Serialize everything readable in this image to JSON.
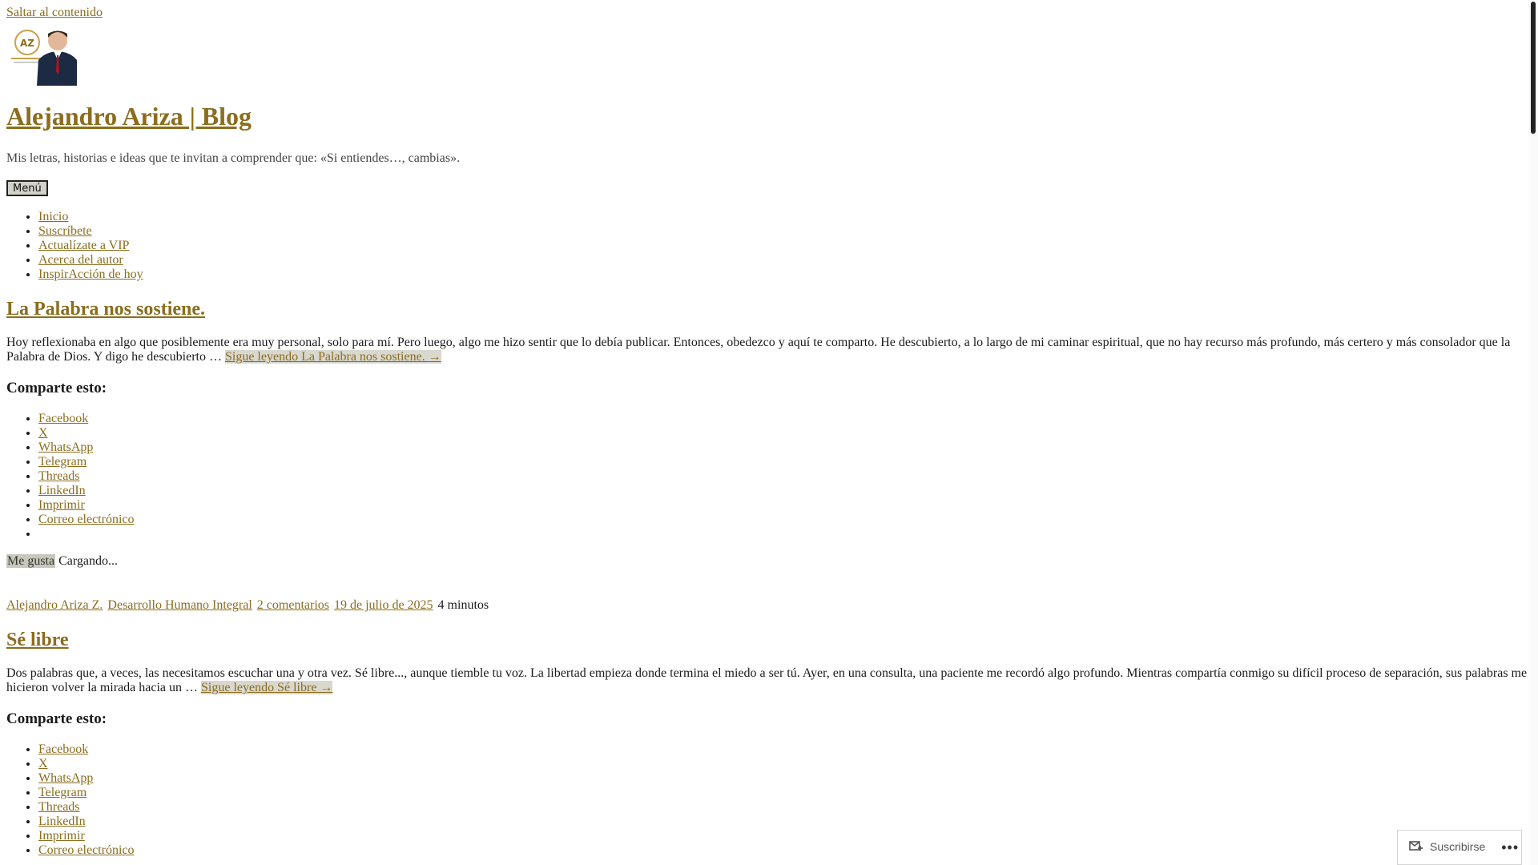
{
  "skip_link": "Saltar al contenido",
  "site": {
    "title": "Alejandro Ariza | Blog",
    "description": "Mis letras, historias e ideas que te invitan a comprender que: «Si entiendes…, cambias».",
    "logo_text": "AZ"
  },
  "menu_toggle": "Menú",
  "nav": [
    "Inicio",
    "Suscríbete",
    "Actualízate a VIP",
    "Acerca del autor",
    "InspirAcción de hoy"
  ],
  "share_heading": "Comparte esto:",
  "share_items": [
    "Facebook",
    "X",
    "WhatsApp",
    "Telegram",
    "Threads",
    "LinkedIn",
    "Imprimir",
    "Correo electrónico"
  ],
  "likes": {
    "button": "Me gusta",
    "status": "Cargando..."
  },
  "posts": [
    {
      "title": "La Palabra nos sostiene.",
      "excerpt": "Hoy reflexionaba en algo que posiblemente era muy personal, solo para mí. Pero luego, algo me hizo sentir que lo debía publicar. Entonces, obedezco y aquí te comparto. He descubierto, a lo largo de mi caminar espiritual, que no hay recurso más profundo, más certero y más consolador que la Palabra de Dios. Y digo he descubierto …",
      "read_more": "Sigue leyendo La Palabra nos sostiene. →",
      "meta": {
        "author": "Alejandro Ariza Z.",
        "category": "Desarrollo Humano Integral",
        "comments": "2 comentarios",
        "date": "19 de julio de 2025",
        "reading_time": "4 minutos"
      }
    },
    {
      "title": "Sé libre",
      "excerpt": "Dos palabras que, a veces, las necesitamos escuchar una y otra vez. Sé libre..., aunque tiemble tu voz. La libertad empieza donde termina el miedo a ser tú. Ayer, en una consulta, una paciente me recordó algo profundo. Mientras compartía conmigo su difícil proceso de separación, sus palabras me hicieron volver la mirada hacia un …",
      "read_more": "Sigue leyendo Sé libre →"
    }
  ],
  "subscribe_bar": {
    "label": "Suscribirse",
    "more_icon": "ellipsis-icon"
  }
}
